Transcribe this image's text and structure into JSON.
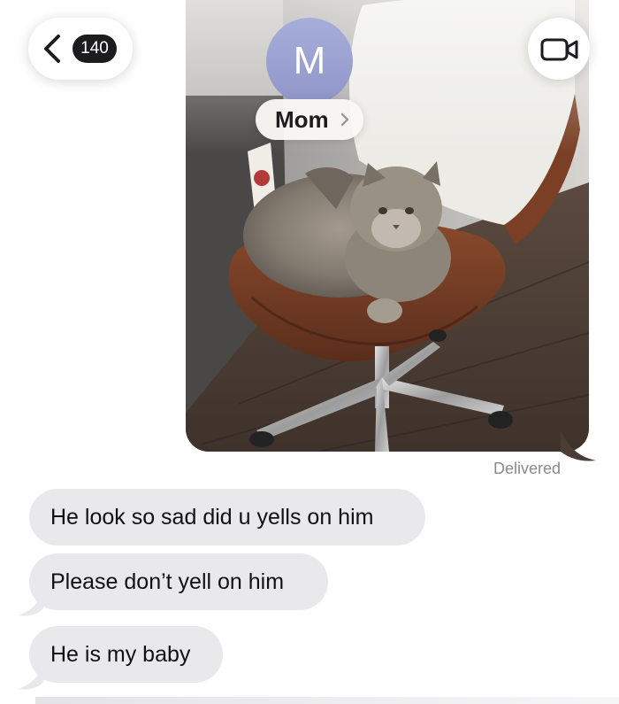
{
  "header": {
    "back_count": "140",
    "avatar_initial": "M",
    "contact_name": "Mom",
    "icons": {
      "back": "chevron-left-icon",
      "contact_details": "chevron-right-icon",
      "video": "video-camera-icon"
    }
  },
  "thread": {
    "sent_photo": {
      "subject": "cat-on-chair-photo"
    },
    "status_text": "Delivered",
    "received_messages": [
      {
        "text": "He look so sad did u yells on him"
      },
      {
        "text": "Please don’t yell on him"
      },
      {
        "text": "He is my baby"
      }
    ]
  },
  "colors": {
    "received_bubble": "#e9e9eb",
    "avatar": "#9aa0d0",
    "status_text": "#8a8a8e"
  }
}
